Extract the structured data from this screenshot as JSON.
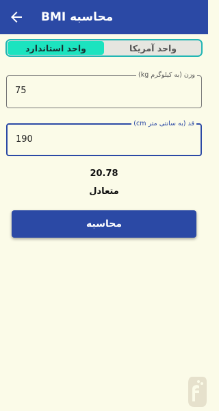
{
  "appbar": {
    "title": "محاسبه BMI",
    "back_icon": "arrow-left-icon",
    "color": "#2b49a5"
  },
  "unit_toggle": {
    "options": [
      "واحد استاندارد",
      "واحد آمریکا"
    ],
    "selected": "واحد استاندارد",
    "accent": "#1ce3bf"
  },
  "weight": {
    "label": "وزن (به کیلوگرم kg)",
    "value": "75"
  },
  "height": {
    "label": "قد (به سانتی متر cm)",
    "value": "190"
  },
  "result": {
    "bmi": "20.78",
    "status": "متعادل"
  },
  "calculate_button": {
    "label": "محاسبه"
  },
  "watermark_icon": "app-store-logo-icon"
}
